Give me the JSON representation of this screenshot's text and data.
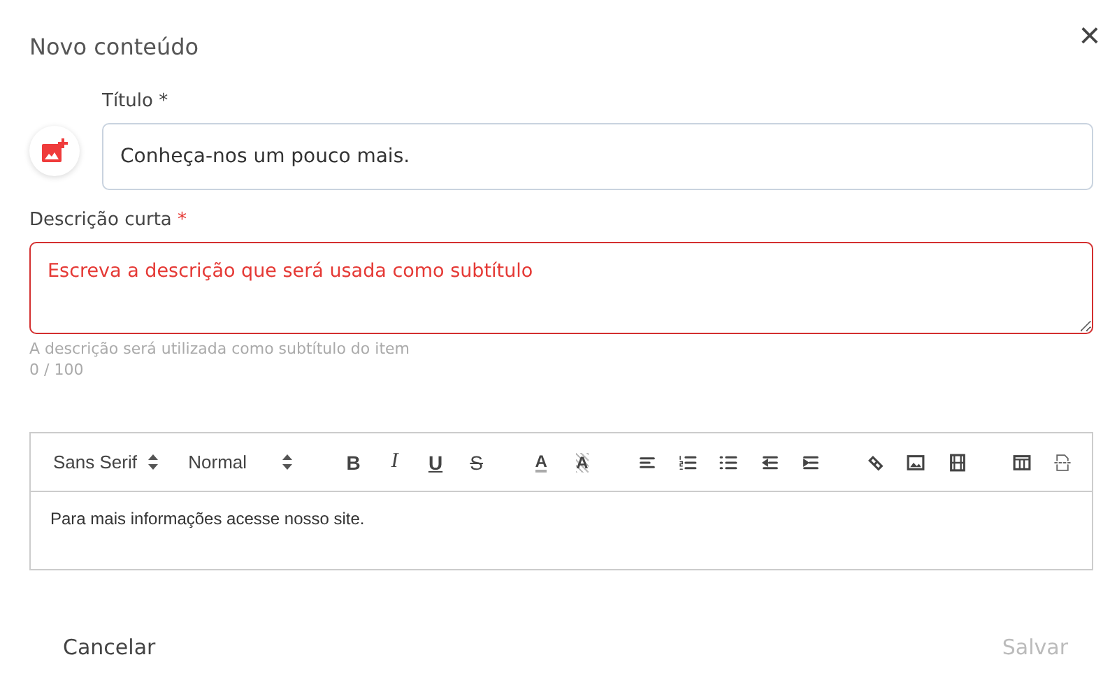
{
  "dialog": {
    "title": "Novo conteúdo",
    "close": "×"
  },
  "title_field": {
    "label": "Título *",
    "value": "Conheça-nos um pouco mais."
  },
  "description_field": {
    "label": "Descrição curta",
    "required_mark": "*",
    "placeholder": "Escreva a descrição que será usada como subtítulo",
    "error": true,
    "hint": "A descrição será utilizada como subtítulo do item",
    "counter": "0 / 100"
  },
  "editor": {
    "toolbar": [
      {
        "kind": "select",
        "label": "Sans Serif"
      },
      {
        "kind": "select",
        "label": "Normal"
      },
      {
        "kind": "gap"
      },
      {
        "kind": "bold",
        "label": "B"
      },
      {
        "kind": "italic",
        "label": "I"
      },
      {
        "kind": "underline",
        "label": "U"
      },
      {
        "kind": "strike",
        "label": "S"
      },
      {
        "kind": "gap"
      },
      {
        "kind": "color",
        "label": "A"
      },
      {
        "kind": "background",
        "label": "A"
      },
      {
        "kind": "gap"
      },
      {
        "kind": "align"
      },
      {
        "kind": "ordered"
      },
      {
        "kind": "bullet"
      },
      {
        "kind": "outdent"
      },
      {
        "kind": "indent"
      },
      {
        "kind": "gap"
      },
      {
        "kind": "link"
      },
      {
        "kind": "image"
      },
      {
        "kind": "video"
      },
      {
        "kind": "gap"
      },
      {
        "kind": "table"
      },
      {
        "kind": "pagebreak"
      }
    ],
    "content": "Para mais informações acesse nosso site."
  },
  "buttons": [
    {
      "label": "Cancelar",
      "disabled": false
    },
    {
      "label": "Salvar",
      "disabled": true
    }
  ]
}
